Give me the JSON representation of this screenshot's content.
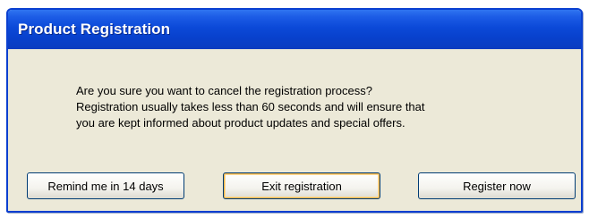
{
  "window": {
    "title": "Product Registration"
  },
  "message": {
    "lines": [
      "Are you sure you want to cancel the registration process?",
      "Registration usually takes less than 60 seconds and will ensure that",
      "you are kept informed about product updates and special offers."
    ]
  },
  "buttons": {
    "remind_label": "Remind me in 14 days",
    "exit_label": "Exit registration",
    "register_label": "Register now"
  },
  "colors": {
    "titlebar": "#0b49d8",
    "dialog_background": "#ece9d8",
    "default_button_highlight": "#f1b44a"
  }
}
